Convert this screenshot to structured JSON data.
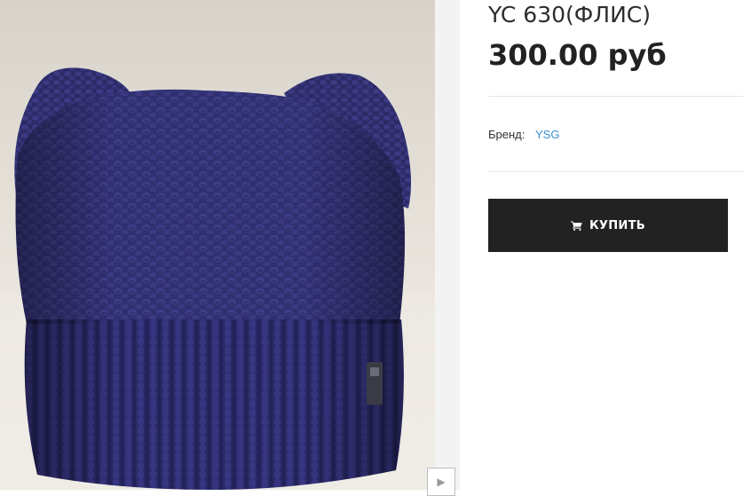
{
  "product": {
    "title": "YC 630(ФЛИС)",
    "price": "300.00 руб",
    "brand_label": "Бренд:",
    "brand_value": "YSG",
    "buy_label": "КУПИТЬ"
  },
  "icons": {
    "cart": "shopping-cart-icon",
    "gallery_next": "chevron-right-icon"
  },
  "colors": {
    "buy_button_bg": "#222222",
    "brand_link": "#3a8fd0",
    "hat": "#2f2e6e"
  }
}
